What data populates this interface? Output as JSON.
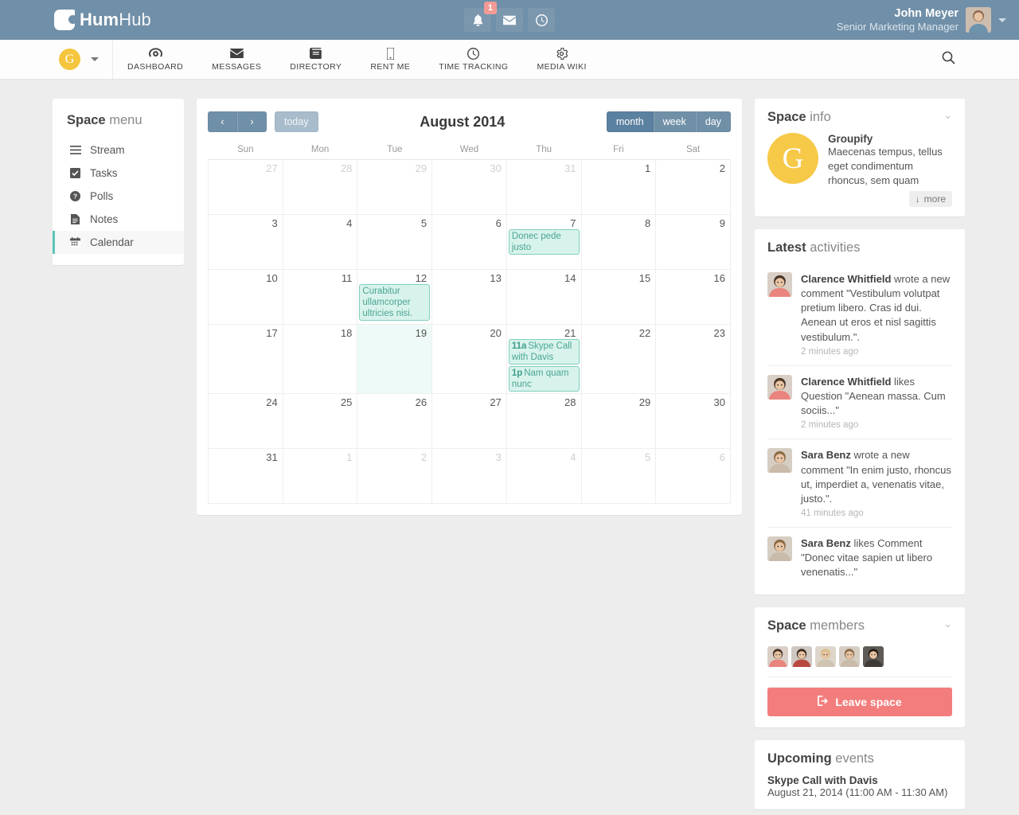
{
  "brand": {
    "bold": "Hum",
    "light": "Hub"
  },
  "header": {
    "icons": [
      {
        "name": "bell-icon",
        "badge": "1"
      },
      {
        "name": "envelope-icon",
        "badge": ""
      },
      {
        "name": "clock-icon",
        "badge": ""
      }
    ],
    "user": {
      "name": "John Meyer",
      "role": "Senior Marketing Manager"
    }
  },
  "nav": {
    "space_initial": "G",
    "items": [
      {
        "label": "DASHBOARD",
        "icon": "dashboard-icon"
      },
      {
        "label": "MESSAGES",
        "icon": "envelope-icon"
      },
      {
        "label": "DIRECTORY",
        "icon": "book-icon"
      },
      {
        "label": "RENT ME",
        "icon": "mobile-icon"
      },
      {
        "label": "TIME TRACKING",
        "icon": "clock-icon"
      },
      {
        "label": "MEDIA WIKI",
        "icon": "gear-icon"
      }
    ]
  },
  "sidebar": {
    "title_bold": "Space",
    "title_light": "menu",
    "items": [
      {
        "label": "Stream",
        "icon": "list-icon",
        "active": false
      },
      {
        "label": "Tasks",
        "icon": "check-square-icon",
        "active": false
      },
      {
        "label": "Polls",
        "icon": "question-circle-icon",
        "active": false
      },
      {
        "label": "Notes",
        "icon": "file-text-icon",
        "active": false
      },
      {
        "label": "Calendar",
        "icon": "calendar-icon",
        "active": true
      }
    ]
  },
  "calendar": {
    "prev_label": "‹",
    "next_label": "›",
    "today_label": "today",
    "title": "August 2014",
    "views": [
      {
        "label": "month",
        "active": true
      },
      {
        "label": "week",
        "active": false
      },
      {
        "label": "day",
        "active": false
      }
    ],
    "weekdays": [
      "Sun",
      "Mon",
      "Tue",
      "Wed",
      "Thu",
      "Fri",
      "Sat"
    ],
    "weeks": [
      [
        {
          "day": "27",
          "other": true,
          "today": false,
          "events": []
        },
        {
          "day": "28",
          "other": true,
          "today": false,
          "events": []
        },
        {
          "day": "29",
          "other": true,
          "today": false,
          "events": []
        },
        {
          "day": "30",
          "other": true,
          "today": false,
          "events": []
        },
        {
          "day": "31",
          "other": true,
          "today": false,
          "events": []
        },
        {
          "day": "1",
          "other": false,
          "today": false,
          "events": []
        },
        {
          "day": "2",
          "other": false,
          "today": false,
          "events": []
        }
      ],
      [
        {
          "day": "3",
          "other": false,
          "today": false,
          "events": []
        },
        {
          "day": "4",
          "other": false,
          "today": false,
          "events": []
        },
        {
          "day": "5",
          "other": false,
          "today": false,
          "events": []
        },
        {
          "day": "6",
          "other": false,
          "today": false,
          "events": []
        },
        {
          "day": "7",
          "other": false,
          "today": false,
          "events": [
            {
              "time": "",
              "title": "Donec pede justo"
            }
          ]
        },
        {
          "day": "8",
          "other": false,
          "today": false,
          "events": []
        },
        {
          "day": "9",
          "other": false,
          "today": false,
          "events": []
        }
      ],
      [
        {
          "day": "10",
          "other": false,
          "today": false,
          "events": []
        },
        {
          "day": "11",
          "other": false,
          "today": false,
          "events": []
        },
        {
          "day": "12",
          "other": false,
          "today": false,
          "events": [
            {
              "time": "",
              "title": "Curabitur ullamcorper ultricies nisi."
            }
          ]
        },
        {
          "day": "13",
          "other": false,
          "today": false,
          "events": []
        },
        {
          "day": "14",
          "other": false,
          "today": false,
          "events": []
        },
        {
          "day": "15",
          "other": false,
          "today": false,
          "events": []
        },
        {
          "day": "16",
          "other": false,
          "today": false,
          "events": []
        }
      ],
      [
        {
          "day": "17",
          "other": false,
          "today": false,
          "events": []
        },
        {
          "day": "18",
          "other": false,
          "today": false,
          "events": []
        },
        {
          "day": "19",
          "other": false,
          "today": true,
          "events": []
        },
        {
          "day": "20",
          "other": false,
          "today": false,
          "events": []
        },
        {
          "day": "21",
          "other": false,
          "today": false,
          "events": [
            {
              "time": "11a",
              "title": "Skype Call with Davis"
            },
            {
              "time": "1p",
              "title": "Nam quam nunc"
            }
          ]
        },
        {
          "day": "22",
          "other": false,
          "today": false,
          "events": []
        },
        {
          "day": "23",
          "other": false,
          "today": false,
          "events": []
        }
      ],
      [
        {
          "day": "24",
          "other": false,
          "today": false,
          "events": []
        },
        {
          "day": "25",
          "other": false,
          "today": false,
          "events": []
        },
        {
          "day": "26",
          "other": false,
          "today": false,
          "events": []
        },
        {
          "day": "27",
          "other": false,
          "today": false,
          "events": []
        },
        {
          "day": "28",
          "other": false,
          "today": false,
          "events": []
        },
        {
          "day": "29",
          "other": false,
          "today": false,
          "events": []
        },
        {
          "day": "30",
          "other": false,
          "today": false,
          "events": []
        }
      ],
      [
        {
          "day": "31",
          "other": false,
          "today": false,
          "events": []
        },
        {
          "day": "1",
          "other": true,
          "today": false,
          "events": []
        },
        {
          "day": "2",
          "other": true,
          "today": false,
          "events": []
        },
        {
          "day": "3",
          "other": true,
          "today": false,
          "events": []
        },
        {
          "day": "4",
          "other": true,
          "today": false,
          "events": []
        },
        {
          "day": "5",
          "other": true,
          "today": false,
          "events": []
        },
        {
          "day": "6",
          "other": true,
          "today": false,
          "events": []
        }
      ]
    ]
  },
  "space_info": {
    "title_bold": "Space",
    "title_light": "info",
    "avatar_letter": "G",
    "name": "Groupify",
    "description": "Maecenas tempus, tellus eget condimentum rhoncus, sem quam",
    "more_label": "more"
  },
  "activities": {
    "title_bold": "Latest",
    "title_light": "activities",
    "items": [
      {
        "user": "Clarence Whitfield",
        "text": " wrote a new comment \"Vestibulum volutpat pretium libero. Cras id dui. Aenean ut eros et nisl sagittis vestibulum.\".",
        "time": "2 minutes ago",
        "avatar": "male1"
      },
      {
        "user": "Clarence Whitfield",
        "text": " likes Question \"Aenean massa. Cum sociis...\"",
        "time": "2 minutes ago",
        "avatar": "male1"
      },
      {
        "user": "Sara Benz",
        "text": " wrote a new comment \"In enim justo, rhoncus ut, imperdiet a, venenatis vitae, justo.\".",
        "time": "41 minutes ago",
        "avatar": "female1"
      },
      {
        "user": "Sara Benz",
        "text": " likes Comment \"Donec vitae sapien ut libero venenatis...\"",
        "time": "",
        "avatar": "female1"
      }
    ]
  },
  "members": {
    "title_bold": "Space",
    "title_light": "members",
    "avatars": [
      "male1",
      "male2",
      "female2",
      "female1",
      "male3"
    ],
    "leave_label": "Leave space"
  },
  "upcoming": {
    "title_bold": "Upcoming",
    "title_light": "events",
    "items": [
      {
        "title": "Skype Call with Davis",
        "when": "August 21, 2014 (11:00 AM - 11:30 AM)"
      }
    ]
  },
  "colors": {
    "header_blue": "#708fa8",
    "accent_teal": "#5bc4b7",
    "event_bg": "#d8f3ec",
    "event_border": "#7fcfbd",
    "space_yellow": "#f7c948",
    "danger_red": "#f37d7d",
    "page_bg": "#ededed"
  }
}
